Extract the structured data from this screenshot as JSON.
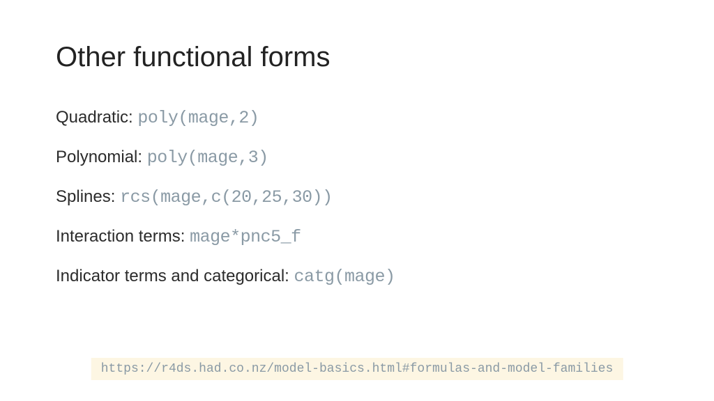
{
  "title": "Other functional forms",
  "items": [
    {
      "label": "Quadratic: ",
      "code": "poly(mage,2)"
    },
    {
      "label": "Polynomial: ",
      "code": "poly(mage,3)"
    },
    {
      "label": "Splines: ",
      "code": "rcs(mage,c(20,25,30))"
    },
    {
      "label": "Interaction terms: ",
      "code": "mage*pnc5_f"
    },
    {
      "label": "Indicator terms and categorical: ",
      "code": "catg(mage)"
    }
  ],
  "footer_url": "https://r4ds.had.co.nz/model-basics.html#formulas-and-model-families"
}
